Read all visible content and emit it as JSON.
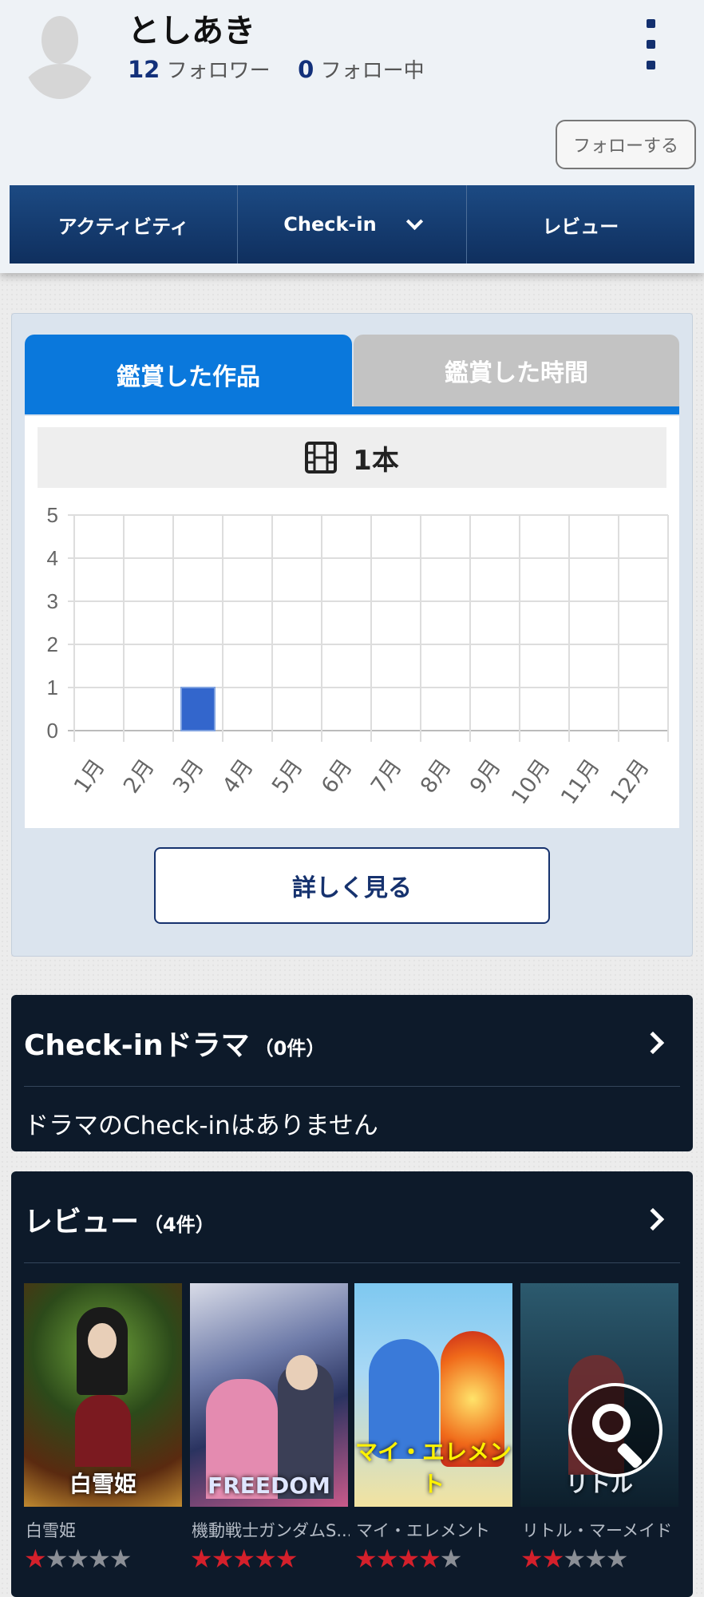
{
  "profile": {
    "name": "としあき",
    "followers_count": "12",
    "followers_label": "フォロワー",
    "following_count": "0",
    "following_label": "フォロー中",
    "follow_button": "フォローする"
  },
  "nav_tabs": [
    {
      "label": "アクティビティ"
    },
    {
      "label": "Check-in"
    },
    {
      "label": "レビュー"
    }
  ],
  "stats": {
    "tab_works": "鑑賞した作品",
    "tab_time": "鑑賞した時間",
    "count_label": "1本",
    "detail_button": "詳しく見る",
    "accent_color": "#0a78dc",
    "bar_color": "#3366cc"
  },
  "chart_data": {
    "type": "bar",
    "categories": [
      "1月",
      "2月",
      "3月",
      "4月",
      "5月",
      "6月",
      "7月",
      "8月",
      "9月",
      "10月",
      "11月",
      "12月"
    ],
    "values": [
      0,
      0,
      1,
      0,
      0,
      0,
      0,
      0,
      0,
      0,
      0,
      0
    ],
    "ylim": [
      0,
      5
    ],
    "yticks": [
      "0",
      "1",
      "2",
      "3",
      "4",
      "5"
    ],
    "grid": true,
    "legend": "none"
  },
  "drama": {
    "title": "Check-inドラマ",
    "count": "（0件）",
    "empty_message": "ドラマのCheck-inはありません"
  },
  "reviews": {
    "title": "レビュー",
    "count": "（4件）",
    "items": [
      {
        "title": "白雪姫",
        "rating": 1,
        "poster_text": "白雪姫",
        "icon": "poster-image"
      },
      {
        "title": "機動戦士ガンダムS...",
        "rating": 5,
        "poster_text": "FREEDOM",
        "icon": "poster-image"
      },
      {
        "title": "マイ・エレメント",
        "rating": 4,
        "poster_text": "マイ・エレメント",
        "icon": "poster-image"
      },
      {
        "title": "リトル・マーメイド",
        "rating": 2,
        "poster_text": "リトル",
        "icon": "poster-image"
      }
    ]
  }
}
